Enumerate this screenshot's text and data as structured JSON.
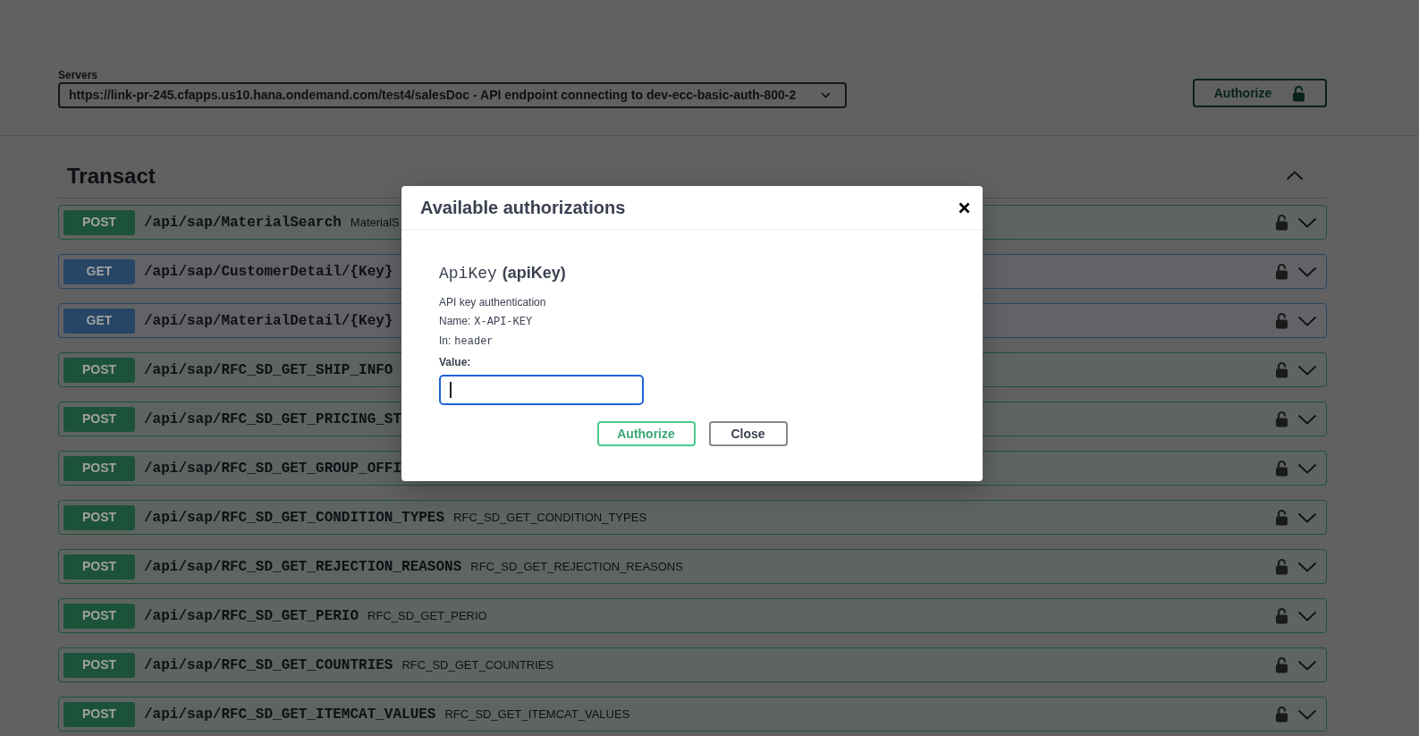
{
  "servers": {
    "label": "Servers",
    "value": "https://link-pr-245.cfapps.us10.hana.ondemand.com/test4/salesDoc - API endpoint connecting to dev-ecc-basic-auth-800-2"
  },
  "authorize_button": {
    "label": "Authorize"
  },
  "section": {
    "title": "Transact",
    "expanded": true
  },
  "operations": [
    {
      "kind": "post",
      "method": "POST",
      "path": "/api/sap/MaterialSearch",
      "summary": "MaterialS",
      "expanded": false
    },
    {
      "kind": "get",
      "method": "GET",
      "path": "/api/sap/CustomerDetail/{Key}",
      "expanded": false
    },
    {
      "kind": "get",
      "method": "GET",
      "path": "/api/sap/MaterialDetail/{Key}",
      "expanded": false
    },
    {
      "kind": "post",
      "method": "POST",
      "path": "/api/sap/RFC_SD_GET_SHIP_INFO",
      "expanded": false
    },
    {
      "kind": "post",
      "method": "POST",
      "path": "/api/sap/RFC_SD_GET_PRICING_ST",
      "expanded": false
    },
    {
      "kind": "post",
      "method": "POST",
      "path": "/api/sap/RFC_SD_GET_GROUP_OFFI",
      "expanded": false
    },
    {
      "kind": "post",
      "method": "POST",
      "path": "/api/sap/RFC_SD_GET_CONDITION_TYPES",
      "summary": "RFC_SD_GET_CONDITION_TYPES",
      "expanded": false
    },
    {
      "kind": "post",
      "method": "POST",
      "path": "/api/sap/RFC_SD_GET_REJECTION_REASONS",
      "summary": "RFC_SD_GET_REJECTION_REASONS",
      "expanded": false
    },
    {
      "kind": "post",
      "method": "POST",
      "path": "/api/sap/RFC_SD_GET_PERIO",
      "summary": "RFC_SD_GET_PERIO",
      "expanded": false
    },
    {
      "kind": "post",
      "method": "POST",
      "path": "/api/sap/RFC_SD_GET_COUNTRIES",
      "summary": "RFC_SD_GET_COUNTRIES",
      "expanded": false
    },
    {
      "kind": "post",
      "method": "POST",
      "path": "/api/sap/RFC_SD_GET_ITEMCAT_VALUES",
      "summary": "RFC_SD_GET_ITEMCAT_VALUES",
      "expanded": false
    }
  ],
  "dialog": {
    "title": "Available authorizations",
    "scheme": {
      "name": "ApiKey",
      "key": "(apiKey)"
    },
    "description": "API key authentication",
    "details": [
      {
        "label": "Name:",
        "value": "X-API-KEY"
      },
      {
        "label": "In:",
        "value": "header"
      }
    ],
    "value_label": "Value:",
    "value_input": {
      "focused": true
    },
    "buttons": [
      {
        "kind": "primary",
        "label": "Authorize"
      },
      {
        "kind": "secondary",
        "label": "Close"
      }
    ]
  }
}
